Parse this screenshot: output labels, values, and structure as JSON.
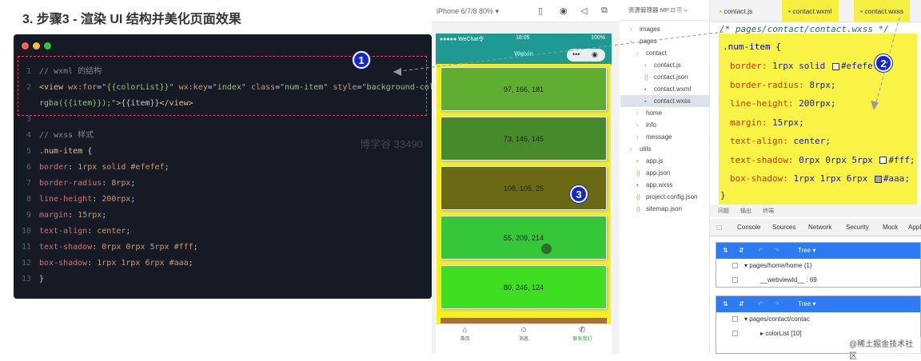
{
  "heading": "3. 步骤3 - 渲染 UI 结构并美化页面效果",
  "colors": {
    "panel_bg": "#161a24",
    "dot_red": "#ff5f56",
    "dot_yellow": "#ffbd2e",
    "dot_green": "#27c93f",
    "badge": "#1527c7",
    "highlight": "#f5ef42"
  },
  "code": {
    "lines": [
      {
        "n": "1",
        "parts": [
          [
            "cm",
            "// wxml 的结构"
          ]
        ]
      },
      {
        "n": "2",
        "parts": [
          [
            "tag",
            "<view "
          ],
          [
            "attr",
            "wx:for"
          ],
          [
            "ct",
            "="
          ],
          [
            "str",
            "\"{{colorList}}\""
          ],
          [
            "ct",
            " "
          ],
          [
            "attr",
            "wx:key"
          ],
          [
            "ct",
            "="
          ],
          [
            "str",
            "\"index\""
          ],
          [
            "ct",
            " "
          ],
          [
            "attr",
            "class"
          ],
          [
            "ct",
            "="
          ],
          [
            "str",
            "\"num-item\""
          ],
          [
            "ct",
            " "
          ],
          [
            "attr",
            "style"
          ],
          [
            "ct",
            "="
          ],
          [
            "str",
            "\"background-color:"
          ]
        ]
      },
      {
        "n": "",
        "parts": [
          [
            "str",
            "rgba({{item}});\""
          ],
          [
            "tag",
            ">"
          ],
          [
            "ct",
            "{{item}}"
          ],
          [
            "tag",
            "</view>"
          ]
        ]
      },
      {
        "n": "3",
        "parts": []
      },
      {
        "n": "4",
        "parts": [
          [
            "cm",
            "// wxss 样式"
          ]
        ]
      },
      {
        "n": "5",
        "parts": [
          [
            "sel",
            ".num-item"
          ],
          [
            "ct",
            " {"
          ]
        ]
      },
      {
        "n": "6",
        "parts": [
          [
            "prop",
            "  border"
          ],
          [
            "ct",
            ": "
          ],
          [
            "val",
            "1rpx solid #efefef"
          ],
          [
            "ct",
            ";"
          ]
        ]
      },
      {
        "n": "7",
        "parts": [
          [
            "prop",
            "  border-radius"
          ],
          [
            "ct",
            ": "
          ],
          [
            "val",
            "8rpx"
          ],
          [
            "ct",
            ";"
          ]
        ]
      },
      {
        "n": "8",
        "parts": [
          [
            "prop",
            "  line-height"
          ],
          [
            "ct",
            ": "
          ],
          [
            "val",
            "200rpx"
          ],
          [
            "ct",
            ";"
          ]
        ]
      },
      {
        "n": "9",
        "parts": [
          [
            "prop",
            "  margin"
          ],
          [
            "ct",
            ": "
          ],
          [
            "val",
            "15rpx"
          ],
          [
            "ct",
            ";"
          ]
        ]
      },
      {
        "n": "10",
        "parts": [
          [
            "prop",
            "  text-align"
          ],
          [
            "ct",
            ": "
          ],
          [
            "val",
            "center"
          ],
          [
            "ct",
            ";"
          ]
        ]
      },
      {
        "n": "11",
        "parts": [
          [
            "prop",
            "  text-shadow"
          ],
          [
            "ct",
            ": "
          ],
          [
            "val",
            "0rpx 0rpx 5rpx #fff"
          ],
          [
            "ct",
            ";"
          ]
        ]
      },
      {
        "n": "12",
        "parts": [
          [
            "prop",
            "  box-shadow"
          ],
          [
            "ct",
            ": "
          ],
          [
            "val",
            "1rpx 1rpx 6rpx #aaa"
          ],
          [
            "ct",
            ";"
          ]
        ]
      },
      {
        "n": "13",
        "parts": [
          [
            "ct",
            "}"
          ]
        ]
      }
    ],
    "watermark": "博学谷 33490"
  },
  "badges": {
    "one": "1",
    "two": "2",
    "three": "3"
  },
  "simulator": {
    "device": "iPhone 6/7/8 80% ▾",
    "status_left": "●●●●● WeChat令",
    "status_time": "18:05",
    "status_right": "100%",
    "nav_title": "Weixin",
    "capsule_dots": "•••",
    "capsule_circle": "◉",
    "items": [
      {
        "label": "97, 166, 181",
        "color": "#5fae32"
      },
      {
        "label": "73, 146, 145",
        "color": "#468a2c"
      },
      {
        "label": "108, 105, 25",
        "color": "#6c6914"
      },
      {
        "label": "55, 209, 214",
        "color": "#36c63a"
      },
      {
        "label": "80, 246, 124",
        "color": "#40de22"
      }
    ],
    "tabs": [
      {
        "icon": "⌂",
        "label": "首页"
      },
      {
        "icon": "☺",
        "label": "消息"
      },
      {
        "icon": "✆",
        "label": "联系我们"
      }
    ]
  },
  "tree": {
    "header": "资源管理器  MP  ⊡  ⎘  ⤷",
    "items": [
      {
        "label": "images",
        "type": "folder"
      },
      {
        "label": "pages",
        "type": "folder"
      },
      {
        "label": "contact",
        "type": "folder"
      },
      {
        "label": "contact.js",
        "type": "js"
      },
      {
        "label": "contact.json",
        "type": "json"
      },
      {
        "label": "contact.wxml",
        "type": "wxml"
      },
      {
        "label": "contact.wxss",
        "type": "wxss"
      },
      {
        "label": "home",
        "type": "folder"
      },
      {
        "label": "info",
        "type": "folder"
      },
      {
        "label": "message",
        "type": "folder"
      },
      {
        "label": "utils",
        "type": "folder"
      },
      {
        "label": "app.js",
        "type": "js"
      },
      {
        "label": "app.json",
        "type": "json"
      },
      {
        "label": "app.wxss",
        "type": "wxss"
      },
      {
        "label": "project.config.json",
        "type": "json"
      },
      {
        "label": "sitemap.json",
        "type": "json"
      }
    ]
  },
  "editor": {
    "tabs": [
      "contact.js",
      "contact.wxml",
      "contact.wxss"
    ],
    "comment": "/* pages/contact/contact.wxss */",
    "selector": ".num-item {",
    "props": [
      {
        "p": "border",
        "v": "1rpx solid ",
        "sw": "#efefef",
        "v2": "#efefef;"
      },
      {
        "p": "border-radius",
        "v": "8rpx;"
      },
      {
        "p": "line-height",
        "v": "200rpx;"
      },
      {
        "p": "margin",
        "v": "15rpx;"
      },
      {
        "p": "text-align",
        "v": "center;"
      },
      {
        "p": "text-shadow",
        "v": "0rpx 0rpx 5rpx ",
        "sw": "#ffffff",
        "v2": "#fff;"
      },
      {
        "p": "box-shadow",
        "v": "1rpx 1rpx 6rpx ",
        "sw": "#aaaaaa",
        "v2": "#aaa;"
      }
    ],
    "close_brace": "}"
  },
  "devtools": {
    "tabs_top": [
      "问题",
      "输出",
      "终端"
    ],
    "tabs": [
      "Console",
      "Sources",
      "Network",
      "Security",
      "Mock",
      "AppD"
    ],
    "panels": [
      {
        "bar": "Tree ▾",
        "rows": [
          "▾  pages/home/home {1}",
          "__webviewId__ : 69"
        ]
      },
      {
        "bar": "Tree ▾",
        "rows": [
          "▾  pages/contact/contac",
          "▸  colorList [10]"
        ]
      }
    ]
  },
  "corner_watermark": "@稀土掘金技术社区"
}
